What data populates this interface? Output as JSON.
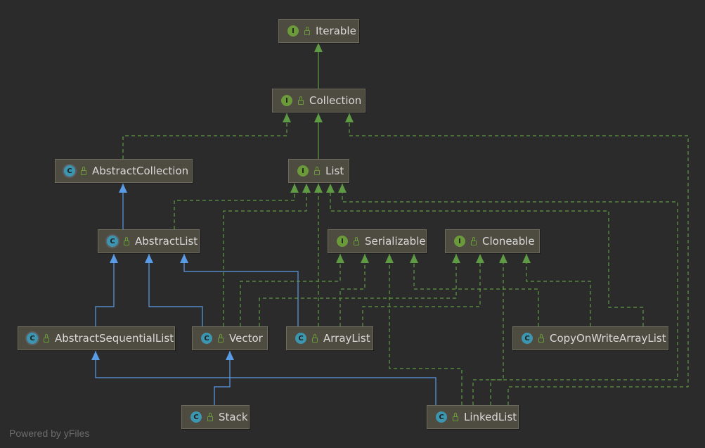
{
  "colors": {
    "background": "#2b2b2b",
    "node_fill": "#4e4b40",
    "node_border": "#6f6b5c",
    "implements_edge": "#5f9a44",
    "extends_edge": "#5a9be6",
    "interface_badge": "#6b9a3a",
    "class_badge": "#3d96b0"
  },
  "nodes": {
    "iterable": {
      "kind": "interface",
      "badge": "I",
      "label": "Iterable"
    },
    "collection": {
      "kind": "interface",
      "badge": "I",
      "label": "Collection"
    },
    "abstract_collection": {
      "kind": "abstract",
      "badge": "C",
      "label": "AbstractCollection"
    },
    "list": {
      "kind": "interface",
      "badge": "I",
      "label": "List"
    },
    "abstract_list": {
      "kind": "abstract",
      "badge": "C",
      "label": "AbstractList"
    },
    "serializable": {
      "kind": "interface",
      "badge": "I",
      "label": "Serializable"
    },
    "cloneable": {
      "kind": "interface",
      "badge": "I",
      "label": "Cloneable"
    },
    "abstract_sequential_list": {
      "kind": "abstract",
      "badge": "C",
      "label": "AbstractSequentialList"
    },
    "vector": {
      "kind": "class",
      "badge": "C",
      "label": "Vector"
    },
    "array_list": {
      "kind": "class",
      "badge": "C",
      "label": "ArrayList"
    },
    "copy_on_write_array_list": {
      "kind": "class",
      "badge": "C",
      "label": "CopyOnWriteArrayList"
    },
    "stack": {
      "kind": "class",
      "badge": "C",
      "label": "Stack"
    },
    "linked_list": {
      "kind": "class",
      "badge": "C",
      "label": "LinkedList"
    }
  },
  "footer": "Powered by yFiles"
}
